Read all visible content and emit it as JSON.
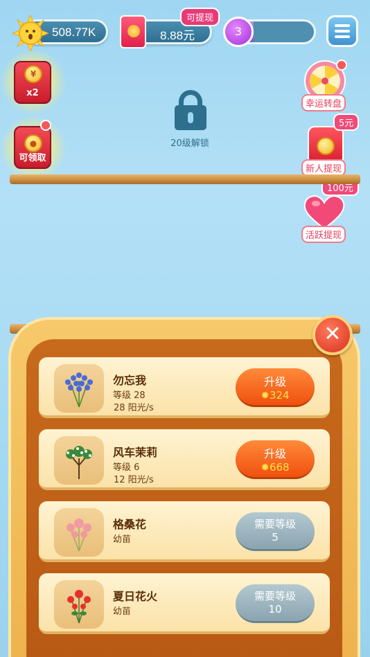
{
  "top_bar": {
    "sun_amount": "508.77K",
    "cash_amount": "8.88元",
    "cash_badge": "可提现",
    "level": "3",
    "level_progress": 0.32
  },
  "left_icons": {
    "double_label": "x2",
    "claim_label": "可领取"
  },
  "right_icons": {
    "lucky_wheel": "幸运转盘",
    "newbie_amount": "5元",
    "newbie_label": "新人提现",
    "active_amount": "100元",
    "active_label": "活跃提现"
  },
  "lock": {
    "label": "20级解锁"
  },
  "flowers": [
    {
      "name": "勿忘我",
      "level": "等级 28",
      "rate": "28 阳光/s",
      "btn_top": "升级",
      "btn_bottom": "324",
      "state": "upgrade"
    },
    {
      "name": "风车茉莉",
      "level": "等级 6",
      "rate": "12 阳光/s",
      "btn_top": "升级",
      "btn_bottom": "668",
      "state": "upgrade"
    },
    {
      "name": "格桑花",
      "level": "幼苗",
      "rate": "",
      "btn_top": "需要等级",
      "btn_bottom": "5",
      "state": "locked"
    },
    {
      "name": "夏日花火",
      "level": "幼苗",
      "rate": "",
      "btn_top": "需要等级",
      "btn_bottom": "10",
      "state": "locked"
    }
  ]
}
